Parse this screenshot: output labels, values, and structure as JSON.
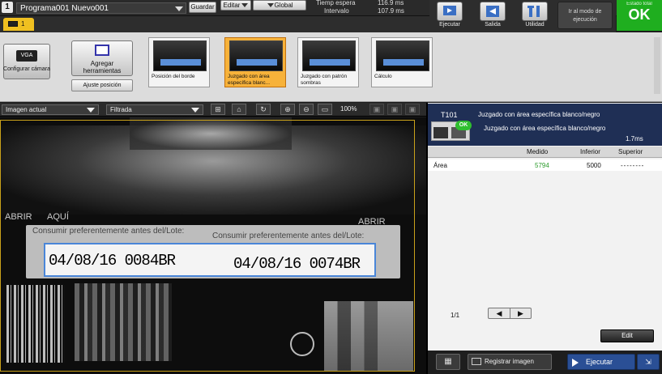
{
  "topbar": {
    "prog_number": "1",
    "program_name": "Programa001  Nuevo001",
    "guardar": "Guardar",
    "editar": "Editar",
    "global": "Global",
    "tiempo_espera_label": "Tiemp espera",
    "tiempo_espera_value": "116.9 ms",
    "intervalo_label": "Intervalo",
    "intervalo_value": "107.9 ms"
  },
  "toolbar_right": {
    "ejecutar": "Ejecutar",
    "salida": "Salida",
    "utilidad": "Utilidad",
    "modo_ejecucion": "Ir al modo de ejecución",
    "estado_label": "Estado total",
    "estado_value": "OK"
  },
  "tabs": {
    "tab1": "1"
  },
  "toolstrip": {
    "vga_chip": "VGA",
    "configurar_camara": "Configurar cámara",
    "agregar_herramientas": "Agregar herramientas",
    "ajuste_posicion": "Ajuste posición",
    "thumbnails": [
      {
        "label": "Posición del borde"
      },
      {
        "label": "Juzgado con área específica blanc..."
      },
      {
        "label": "Juzgado con patrón sombras"
      },
      {
        "label": "Cálculo"
      }
    ]
  },
  "imagebar": {
    "imagen_actual": "Imagen actual",
    "filtrada": "Filtrada",
    "zoom": "100%"
  },
  "camera": {
    "abrir_left": "ABRIR",
    "aqui": "AQUÍ",
    "abrir_right": "ABRIR",
    "label_line1": "Consumir preferentemente antes del/Lote:",
    "label_line2": "Consumir preferentemente antes del/Lote:",
    "date1": "04/08/16 0084BR",
    "date2": "04/08/16 0074BR"
  },
  "panel": {
    "tool_id": "T101",
    "tool_name1": "Juzgado con área específica blanco/negro",
    "tool_name2": "Juzgado con área específica blanco/negro",
    "tool_status": "OK",
    "tool_time": "1.7ms",
    "columns": {
      "medido": "Medido",
      "inferior": "Inferior",
      "superior": "Superior"
    },
    "rows": [
      {
        "name": "Área",
        "medido": "5794",
        "inferior": "5000",
        "superior": "--------"
      }
    ],
    "page_indicator": "1/1",
    "prev": "◀",
    "next": "▶",
    "edit": "Edit"
  },
  "bottombar": {
    "registrar_imagen": "Registrar imagen",
    "ejecutar": "Ejecutar"
  },
  "colors": {
    "ok_green": "#1fae1f",
    "selected_tool": "#f7b23a",
    "panel_header": "#1f2f55",
    "measured_green": "#2a9a2a"
  }
}
